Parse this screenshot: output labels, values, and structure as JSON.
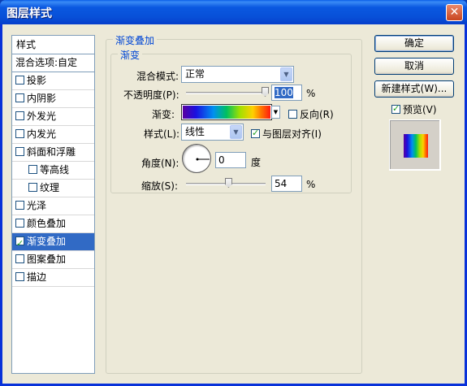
{
  "window": {
    "title": "图层样式",
    "close_glyph": "✕"
  },
  "sidebar": {
    "header": "样式",
    "blend_options": "混合选项:自定",
    "items": [
      {
        "label": "投影",
        "checked": false,
        "indent": false,
        "selected": false
      },
      {
        "label": "内阴影",
        "checked": false,
        "indent": false,
        "selected": false
      },
      {
        "label": "外发光",
        "checked": false,
        "indent": false,
        "selected": false
      },
      {
        "label": "内发光",
        "checked": false,
        "indent": false,
        "selected": false
      },
      {
        "label": "斜面和浮雕",
        "checked": false,
        "indent": false,
        "selected": false
      },
      {
        "label": "等高线",
        "checked": false,
        "indent": true,
        "selected": false
      },
      {
        "label": "纹理",
        "checked": false,
        "indent": true,
        "selected": false
      },
      {
        "label": "光泽",
        "checked": false,
        "indent": false,
        "selected": false
      },
      {
        "label": "颜色叠加",
        "checked": false,
        "indent": false,
        "selected": false
      },
      {
        "label": "渐变叠加",
        "checked": true,
        "indent": false,
        "selected": true
      },
      {
        "label": "图案叠加",
        "checked": false,
        "indent": false,
        "selected": false
      },
      {
        "label": "描边",
        "checked": false,
        "indent": false,
        "selected": false
      }
    ]
  },
  "panel": {
    "outer_title": "渐变叠加",
    "inner_title": "渐变",
    "blend_mode_label": "混合模式:",
    "blend_mode_value": "正常",
    "opacity_label": "不透明度(P):",
    "opacity_value": "100",
    "opacity_unit": "%",
    "opacity_fraction": 1.0,
    "gradient_label": "渐变:",
    "reverse_label": "反向(R)",
    "reverse_checked": false,
    "style_label": "样式(L):",
    "style_value": "线性",
    "align_label": "与图层对齐(I)",
    "align_checked": true,
    "angle_label": "角度(N):",
    "angle_value": "0",
    "angle_unit": "度",
    "scale_label": "缩放(S):",
    "scale_value": "54",
    "scale_unit": "%",
    "scale_fraction": 0.54
  },
  "buttons": {
    "ok": "确定",
    "cancel": "取消",
    "new_style": "新建样式(W)...",
    "preview_label": "预览(V)",
    "preview_checked": true
  }
}
